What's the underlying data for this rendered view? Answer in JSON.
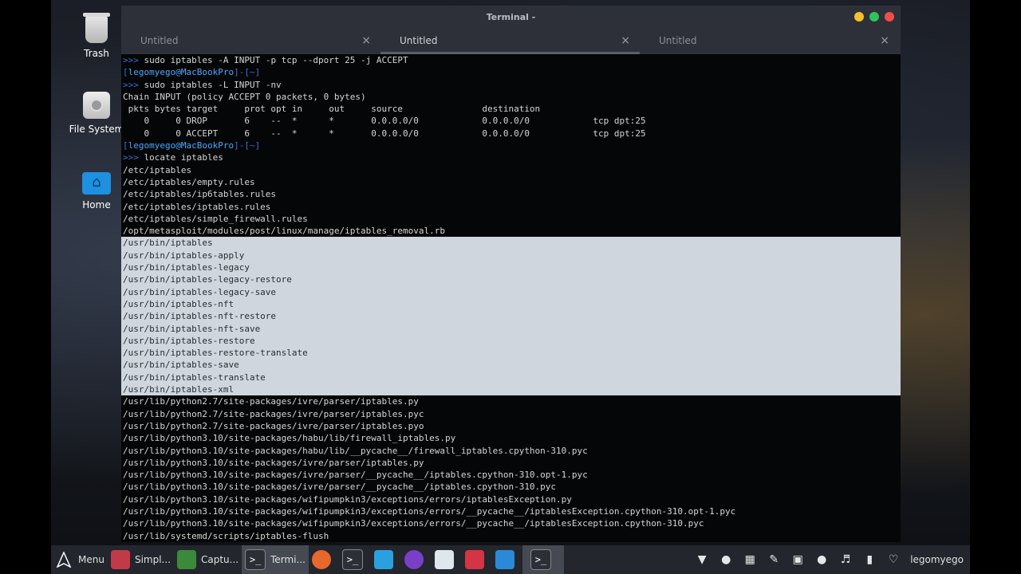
{
  "desktop": {
    "icons": [
      {
        "label": "Trash"
      },
      {
        "label": "File System"
      },
      {
        "label": "Home"
      }
    ]
  },
  "window": {
    "title": "Terminal -",
    "traffic_colors": [
      "#f5c02b",
      "#2fc45a",
      "#f14c4c"
    ],
    "tabs": [
      {
        "label": "Untitled",
        "close": "×"
      },
      {
        "label": "Untitled",
        "close": "×"
      },
      {
        "label": "Untitled",
        "close": "×"
      }
    ]
  },
  "terminal": {
    "lines": [
      ">>> sudo iptables -A INPUT -p tcp --dport 25 -j ACCEPT",
      "[legomyego@MacBookPro]-[~]",
      ">>> sudo iptables -L INPUT -nv",
      "Chain INPUT (policy ACCEPT 0 packets, 0 bytes)",
      " pkts bytes target     prot opt in     out     source               destination",
      "    0     0 DROP       6    --  *      *       0.0.0.0/0            0.0.0.0/0            tcp dpt:25",
      "    0     0 ACCEPT     6    --  *      *       0.0.0.0/0            0.0.0.0/0            tcp dpt:25",
      "[legomyego@MacBookPro]-[~]",
      ">>> locate iptables",
      "/etc/iptables",
      "/etc/iptables/empty.rules",
      "/etc/iptables/ip6tables.rules",
      "/etc/iptables/iptables.rules",
      "/etc/iptables/simple_firewall.rules",
      "/opt/metasploit/modules/post/linux/manage/iptables_removal.rb",
      "/usr/bin/iptables",
      "/usr/bin/iptables-apply",
      "/usr/bin/iptables-legacy",
      "/usr/bin/iptables-legacy-restore",
      "/usr/bin/iptables-legacy-save",
      "/usr/bin/iptables-nft",
      "/usr/bin/iptables-nft-restore",
      "/usr/bin/iptables-nft-save",
      "/usr/bin/iptables-restore",
      "/usr/bin/iptables-restore-translate",
      "/usr/bin/iptables-save",
      "/usr/bin/iptables-translate",
      "/usr/bin/iptables-xml",
      "/usr/lib/python2.7/site-packages/ivre/parser/iptables.py",
      "/usr/lib/python2.7/site-packages/ivre/parser/iptables.pyc",
      "/usr/lib/python2.7/site-packages/ivre/parser/iptables.pyo",
      "/usr/lib/python3.10/site-packages/habu/lib/firewall_iptables.py",
      "/usr/lib/python3.10/site-packages/habu/lib/__pycache__/firewall_iptables.cpython-310.pyc",
      "/usr/lib/python3.10/site-packages/ivre/parser/iptables.py",
      "/usr/lib/python3.10/site-packages/ivre/parser/__pycache__/iptables.cpython-310.opt-1.pyc",
      "/usr/lib/python3.10/site-packages/ivre/parser/__pycache__/iptables.cpython-310.pyc",
      "/usr/lib/python3.10/site-packages/wifipumpkin3/exceptions/errors/iptablesException.py",
      "/usr/lib/python3.10/site-packages/wifipumpkin3/exceptions/errors/__pycache__/iptablesException.cpython-310.opt-1.pyc",
      "/usr/lib/python3.10/site-packages/wifipumpkin3/exceptions/errors/__pycache__/iptablesException.cpython-310.pyc",
      "/usr/lib/systemd/scripts/iptables-flush"
    ],
    "selected_range": [
      15,
      27
    ]
  },
  "taskbar": {
    "menu_label": "Menu",
    "items": [
      {
        "label": "Simpl...",
        "icon": "screen-recorder-icon",
        "color": "#c23a4a"
      },
      {
        "label": "Captu...",
        "icon": "capture-icon",
        "color": "#3a8a3a"
      },
      {
        "label": "Termi...",
        "icon": "terminal-icon",
        "color": "#2b2f36"
      }
    ],
    "launchers": [
      {
        "icon": "firefox-icon",
        "color": "#e8672c"
      },
      {
        "icon": "terminal-launcher-icon",
        "color": "#2b2f36"
      },
      {
        "icon": "notes-icon",
        "color": "#2aa0e0"
      },
      {
        "icon": "tor-icon",
        "color": "#7a3fc8"
      },
      {
        "icon": "text-editor-icon",
        "color": "#dfe6ee"
      },
      {
        "icon": "recorder-icon",
        "color": "#d43444"
      },
      {
        "icon": "system-monitor-icon",
        "color": "#2a8ad8"
      },
      {
        "icon": "active-terminal-icon",
        "color": "#2b2f36"
      }
    ],
    "tray": {
      "username": "legomyego"
    }
  }
}
